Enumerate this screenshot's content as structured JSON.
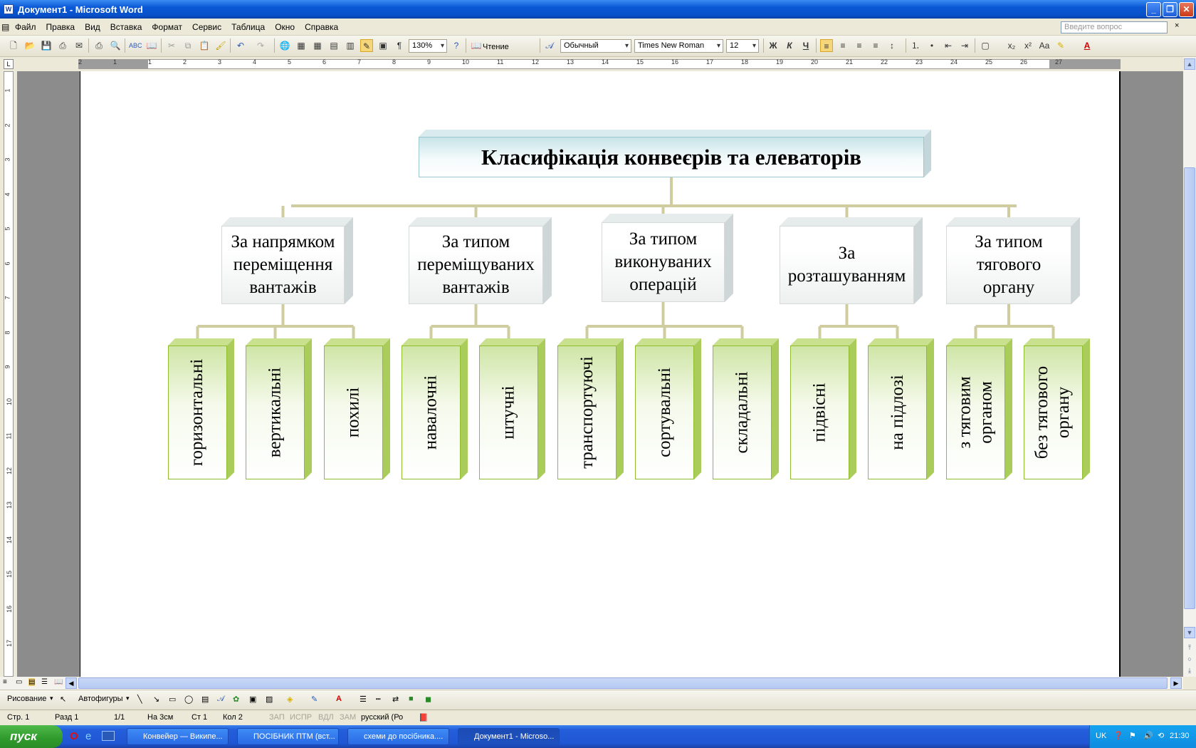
{
  "window": {
    "title": "Документ1 - Microsoft Word"
  },
  "menu": [
    "Файл",
    "Правка",
    "Вид",
    "Вставка",
    "Формат",
    "Сервис",
    "Таблица",
    "Окно",
    "Справка"
  ],
  "ask_placeholder": "Введите вопрос",
  "toolbar": {
    "zoom": "130%",
    "reading": "Чтение",
    "style": "Обычный",
    "font": "Times New Roman",
    "size": "12",
    "bold": "Ж",
    "italic": "К",
    "underline": "Ч"
  },
  "ruler_numbers": [
    "2",
    "1",
    "1",
    "2",
    "3",
    "4",
    "5",
    "6",
    "7",
    "8",
    "9",
    "10",
    "11",
    "12",
    "13",
    "14",
    "15",
    "16",
    "17",
    "18",
    "19",
    "20",
    "21",
    "22",
    "23",
    "24",
    "25",
    "26",
    "27"
  ],
  "vruler_numbers": [
    "1",
    "2",
    "3",
    "4",
    "5",
    "6",
    "7",
    "8",
    "9",
    "10",
    "11",
    "12",
    "13",
    "14",
    "15",
    "16",
    "17"
  ],
  "diagram": {
    "title": "Класифікація конвеєрів та елеваторів",
    "categories": [
      {
        "label": [
          "За напрямком",
          "переміщення",
          "вантажів"
        ],
        "items": [
          [
            "горизонтальні"
          ],
          [
            "вертикальні"
          ],
          [
            "похилі"
          ]
        ]
      },
      {
        "label": [
          "За типом",
          "переміщуваних",
          "вантажів"
        ],
        "items": [
          [
            "навалочні"
          ],
          [
            "штучні"
          ]
        ]
      },
      {
        "label": [
          "За типом",
          "виконуваних",
          "операцій"
        ],
        "items": [
          [
            "транспортуючі"
          ],
          [
            "сортувальні"
          ],
          [
            "складальні"
          ]
        ]
      },
      {
        "label": [
          "За",
          "розташуванням"
        ],
        "items": [
          [
            "підвісні"
          ],
          [
            "на підлозі"
          ]
        ]
      },
      {
        "label": [
          "За типом",
          "тягового",
          "органу"
        ],
        "items": [
          [
            "з тяговим",
            "органом"
          ],
          [
            "без тягового",
            "органу"
          ]
        ]
      }
    ]
  },
  "drawbar": {
    "drawing": "Рисование",
    "autoshapes": "Автофигуры"
  },
  "status": {
    "page": "Стр. 1",
    "section": "Разд 1",
    "pages": "1/1",
    "at": "На 3см",
    "line": "Ст 1",
    "col": "Кол 2",
    "rec": "ЗАП",
    "trk": "ИСПР",
    "ext": "ВДЛ",
    "ovr": "ЗАМ",
    "lang": "русский (Ро"
  },
  "taskbar": {
    "start": "пуск",
    "tasks": [
      "Конвейер — Википе...",
      "ПОСІБНИК ПТМ (вст...",
      "схеми до посібника....",
      "Документ1 - Microso..."
    ],
    "lang": "UK",
    "time": "21:30"
  }
}
